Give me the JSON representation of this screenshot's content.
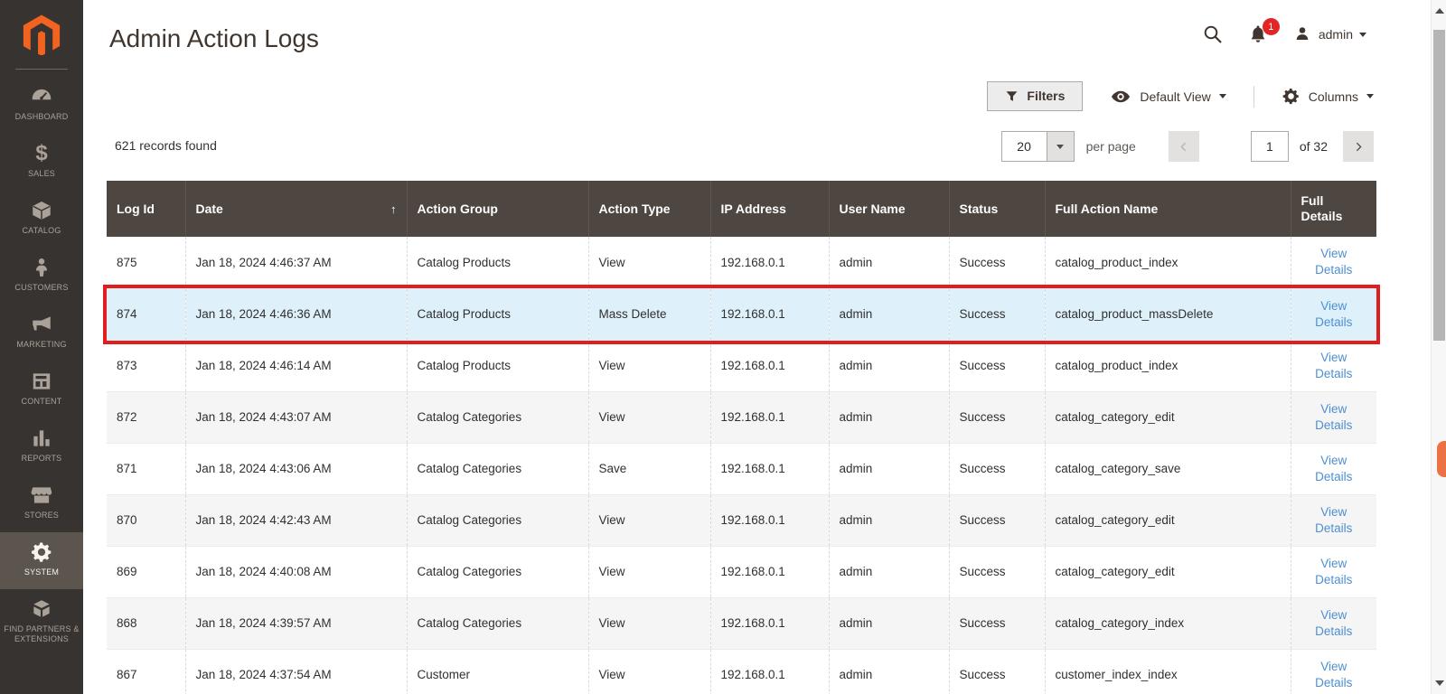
{
  "sidebar": {
    "items": [
      {
        "label": "DASHBOARD",
        "icon": "dashboard-icon",
        "active": false
      },
      {
        "label": "SALES",
        "icon": "sales-icon",
        "active": false
      },
      {
        "label": "CATALOG",
        "icon": "catalog-icon",
        "active": false
      },
      {
        "label": "CUSTOMERS",
        "icon": "customers-icon",
        "active": false
      },
      {
        "label": "MARKETING",
        "icon": "marketing-icon",
        "active": false
      },
      {
        "label": "CONTENT",
        "icon": "content-icon",
        "active": false
      },
      {
        "label": "REPORTS",
        "icon": "reports-icon",
        "active": false
      },
      {
        "label": "STORES",
        "icon": "stores-icon",
        "active": false
      },
      {
        "label": "SYSTEM",
        "icon": "system-icon",
        "active": true
      },
      {
        "label": "FIND PARTNERS & EXTENSIONS",
        "icon": "extensions-icon",
        "active": false
      }
    ]
  },
  "header": {
    "title": "Admin Action Logs",
    "notification_count": "1",
    "user_name": "admin"
  },
  "toolbar": {
    "filters_label": "Filters",
    "view_label": "Default View",
    "columns_label": "Columns"
  },
  "grid": {
    "records_found": "621 records found",
    "per_page_value": "20",
    "per_page_label": "per page",
    "current_page": "1",
    "total_pages_label": "of 32",
    "columns": [
      "Log Id",
      "Date",
      "Action Group",
      "Action Type",
      "IP Address",
      "User Name",
      "Status",
      "Full Action Name",
      "Full Details"
    ],
    "sort_column": "Date",
    "sort_direction": "↑",
    "view_details_label": "View Details",
    "rows": [
      {
        "log_id": "875",
        "date": "Jan 18, 2024 4:46:37 AM",
        "action_group": "Catalog Products",
        "action_type": "View",
        "ip": "192.168.0.1",
        "user": "admin",
        "status": "Success",
        "full_action": "catalog_product_index",
        "highlighted": false
      },
      {
        "log_id": "874",
        "date": "Jan 18, 2024 4:46:36 AM",
        "action_group": "Catalog Products",
        "action_type": "Mass Delete",
        "ip": "192.168.0.1",
        "user": "admin",
        "status": "Success",
        "full_action": "catalog_product_massDelete",
        "highlighted": true
      },
      {
        "log_id": "873",
        "date": "Jan 18, 2024 4:46:14 AM",
        "action_group": "Catalog Products",
        "action_type": "View",
        "ip": "192.168.0.1",
        "user": "admin",
        "status": "Success",
        "full_action": "catalog_product_index",
        "highlighted": false
      },
      {
        "log_id": "872",
        "date": "Jan 18, 2024 4:43:07 AM",
        "action_group": "Catalog Categories",
        "action_type": "View",
        "ip": "192.168.0.1",
        "user": "admin",
        "status": "Success",
        "full_action": "catalog_category_edit",
        "highlighted": false
      },
      {
        "log_id": "871",
        "date": "Jan 18, 2024 4:43:06 AM",
        "action_group": "Catalog Categories",
        "action_type": "Save",
        "ip": "192.168.0.1",
        "user": "admin",
        "status": "Success",
        "full_action": "catalog_category_save",
        "highlighted": false
      },
      {
        "log_id": "870",
        "date": "Jan 18, 2024 4:42:43 AM",
        "action_group": "Catalog Categories",
        "action_type": "View",
        "ip": "192.168.0.1",
        "user": "admin",
        "status": "Success",
        "full_action": "catalog_category_edit",
        "highlighted": false
      },
      {
        "log_id": "869",
        "date": "Jan 18, 2024 4:40:08 AM",
        "action_group": "Catalog Categories",
        "action_type": "View",
        "ip": "192.168.0.1",
        "user": "admin",
        "status": "Success",
        "full_action": "catalog_category_edit",
        "highlighted": false
      },
      {
        "log_id": "868",
        "date": "Jan 18, 2024 4:39:57 AM",
        "action_group": "Catalog Categories",
        "action_type": "View",
        "ip": "192.168.0.1",
        "user": "admin",
        "status": "Success",
        "full_action": "catalog_category_index",
        "highlighted": false
      },
      {
        "log_id": "867",
        "date": "Jan 18, 2024 4:37:54 AM",
        "action_group": "Customer",
        "action_type": "View",
        "ip": "192.168.0.1",
        "user": "admin",
        "status": "Success",
        "full_action": "customer_index_index",
        "highlighted": false
      }
    ]
  },
  "colors": {
    "sidebar_bg": "#373330",
    "sidebar_active_bg": "#5b554e",
    "logo_orange": "#f26322",
    "grid_header_bg": "#4e4640",
    "highlight_row_bg": "#def1fb",
    "highlight_border": "#e01e1f",
    "notification_badge": "#e22626",
    "link_blue": "#4d8fd2"
  }
}
